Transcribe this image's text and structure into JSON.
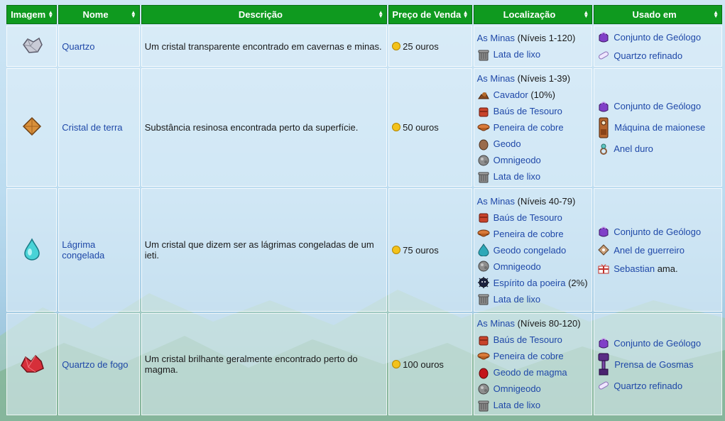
{
  "columns": [
    "Imagem",
    "Nome",
    "Descrição",
    "Preço de Venda",
    "Localização",
    "Usado em"
  ],
  "rows": [
    {
      "name": "Quartzo",
      "description": "Um cristal transparente encontrado em cavernas e minas.",
      "price": "25 ouros",
      "locations": [
        {
          "icon": "mines",
          "link": "As Minas",
          "suffix": " (Níveis 1-120)"
        },
        {
          "icon": "trash-can-icon",
          "link": "Lata de lixo",
          "suffix": ""
        }
      ],
      "used_in": [
        {
          "icon": "geode-bundle-icon",
          "link": "Conjunto de Geólogo",
          "suffix": ""
        },
        {
          "icon": "refined-quartz-icon",
          "link": "Quartzo refinado",
          "suffix": ""
        }
      ]
    },
    {
      "name": "Cristal de terra",
      "description": "Substância resinosa encontrada perto da superfície.",
      "price": "50 ouros",
      "locations": [
        {
          "icon": "mines",
          "link": "As Minas",
          "suffix": " (Níveis 1-39)"
        },
        {
          "icon": "duggy-icon",
          "link": "Cavador",
          "suffix": " (10%)"
        },
        {
          "icon": "treasure-chest-icon",
          "link": "Baús de Tesouro",
          "suffix": ""
        },
        {
          "icon": "copper-pan-icon",
          "link": "Peneira de cobre",
          "suffix": ""
        },
        {
          "icon": "geode-icon",
          "link": "Geodo",
          "suffix": ""
        },
        {
          "icon": "omni-geode-icon",
          "link": "Omnigeodo",
          "suffix": ""
        },
        {
          "icon": "trash-can-icon",
          "link": "Lata de lixo",
          "suffix": ""
        }
      ],
      "used_in": [
        {
          "icon": "geode-bundle-icon",
          "link": "Conjunto de Geólogo",
          "suffix": ""
        },
        {
          "icon": "mayonnaise-machine-icon",
          "link": "Máquina de maionese",
          "suffix": ""
        },
        {
          "icon": "hard-ring-icon",
          "link": "Anel duro",
          "suffix": ""
        }
      ]
    },
    {
      "name": "Lágrima congelada",
      "description": "Um cristal que dizem ser as lágrimas congeladas de um ieti.",
      "price": "75 ouros",
      "locations": [
        {
          "icon": "mines",
          "link": "As Minas",
          "suffix": " (Níveis 40-79)"
        },
        {
          "icon": "treasure-chest-icon",
          "link": "Baús de Tesouro",
          "suffix": ""
        },
        {
          "icon": "copper-pan-icon",
          "link": "Peneira de cobre",
          "suffix": ""
        },
        {
          "icon": "frozen-geode-icon",
          "link": "Geodo congelado",
          "suffix": ""
        },
        {
          "icon": "omni-geode-icon",
          "link": "Omnigeodo",
          "suffix": ""
        },
        {
          "icon": "dust-sprite-icon",
          "link": "Espírito da poeira",
          "suffix": " (2%)"
        },
        {
          "icon": "trash-can-icon",
          "link": "Lata de lixo",
          "suffix": ""
        }
      ],
      "used_in": [
        {
          "icon": "geode-bundle-icon",
          "link": "Conjunto de Geólogo",
          "suffix": ""
        },
        {
          "icon": "warrior-ring-icon",
          "link": "Anel de guerreiro",
          "suffix": ""
        },
        {
          "icon": "gift-icon",
          "link": "Sebastian",
          "suffix": " ama."
        }
      ]
    },
    {
      "name": "Quartzo de fogo",
      "description": "Um cristal brilhante geralmente encontrado perto do magma.",
      "price": "100 ouros",
      "locations": [
        {
          "icon": "mines",
          "link": "As Minas",
          "suffix": " (Níveis 80-120)"
        },
        {
          "icon": "treasure-chest-icon",
          "link": "Baús de Tesouro",
          "suffix": ""
        },
        {
          "icon": "copper-pan-icon",
          "link": "Peneira de cobre",
          "suffix": ""
        },
        {
          "icon": "magma-geode-icon",
          "link": "Geodo de magma",
          "suffix": ""
        },
        {
          "icon": "omni-geode-icon",
          "link": "Omnigeodo",
          "suffix": ""
        },
        {
          "icon": "trash-can-icon",
          "link": "Lata de lixo",
          "suffix": ""
        }
      ],
      "used_in": [
        {
          "icon": "geode-bundle-icon",
          "link": "Conjunto de Geólogo",
          "suffix": ""
        },
        {
          "icon": "slime-press-icon",
          "link": "Prensa de Gosmas",
          "suffix": ""
        },
        {
          "icon": "refined-quartz-icon",
          "link": "Quartzo refinado",
          "suffix": ""
        }
      ]
    }
  ],
  "colors": {
    "header": "#0f9a1f",
    "link": "#1f48a8",
    "coin": "#f3c21b"
  }
}
